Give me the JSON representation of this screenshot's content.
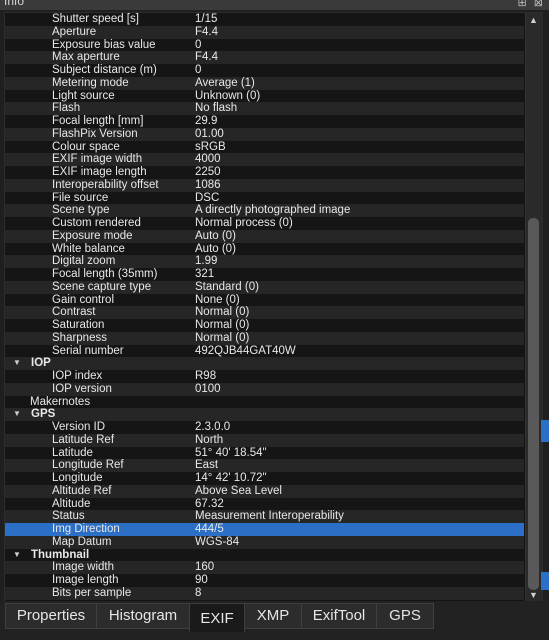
{
  "window": {
    "title": "Info",
    "controls": "⊞ ⊠"
  },
  "rows": [
    {
      "type": "field",
      "key": "Shutter speed [s]",
      "value": "1/15"
    },
    {
      "type": "field",
      "key": "Aperture",
      "value": "F4.4"
    },
    {
      "type": "field",
      "key": "Exposure bias value",
      "value": "0"
    },
    {
      "type": "field",
      "key": "Max aperture",
      "value": "F4.4"
    },
    {
      "type": "field",
      "key": "Subject distance (m)",
      "value": "0"
    },
    {
      "type": "field",
      "key": "Metering mode",
      "value": "Average (1)"
    },
    {
      "type": "field",
      "key": "Light source",
      "value": "Unknown (0)"
    },
    {
      "type": "field",
      "key": "Flash",
      "value": "No flash"
    },
    {
      "type": "field",
      "key": "Focal length [mm]",
      "value": "29.9"
    },
    {
      "type": "field",
      "key": "FlashPix Version",
      "value": "01.00"
    },
    {
      "type": "field",
      "key": "Colour space",
      "value": "sRGB"
    },
    {
      "type": "field",
      "key": "EXIF image width",
      "value": "4000"
    },
    {
      "type": "field",
      "key": "EXIF image length",
      "value": "2250"
    },
    {
      "type": "field",
      "key": "Interoperability offset",
      "value": "1086"
    },
    {
      "type": "field",
      "key": "File source",
      "value": "DSC"
    },
    {
      "type": "field",
      "key": "Scene type",
      "value": "A directly photographed image"
    },
    {
      "type": "field",
      "key": "Custom rendered",
      "value": "Normal process (0)"
    },
    {
      "type": "field",
      "key": "Exposure mode",
      "value": "Auto (0)"
    },
    {
      "type": "field",
      "key": "White balance",
      "value": "Auto (0)"
    },
    {
      "type": "field",
      "key": "Digital zoom",
      "value": "1.99"
    },
    {
      "type": "field",
      "key": "Focal length (35mm)",
      "value": "321"
    },
    {
      "type": "field",
      "key": "Scene capture type",
      "value": "Standard (0)"
    },
    {
      "type": "field",
      "key": "Gain control",
      "value": "None (0)"
    },
    {
      "type": "field",
      "key": "Contrast",
      "value": "Normal (0)"
    },
    {
      "type": "field",
      "key": "Saturation",
      "value": "Normal (0)"
    },
    {
      "type": "field",
      "key": "Sharpness",
      "value": "Normal (0)"
    },
    {
      "type": "field",
      "key": "Serial number",
      "value": "492QJB44GAT40W"
    },
    {
      "type": "group",
      "key": "IOP",
      "value": ""
    },
    {
      "type": "field",
      "key": "IOP index",
      "value": "R98"
    },
    {
      "type": "field",
      "key": "IOP version",
      "value": "0100"
    },
    {
      "type": "plain",
      "key": "Makernotes",
      "value": ""
    },
    {
      "type": "group",
      "key": "GPS",
      "value": ""
    },
    {
      "type": "field",
      "key": "Version ID",
      "value": "2.3.0.0"
    },
    {
      "type": "field",
      "key": "Latitude Ref",
      "value": "North"
    },
    {
      "type": "field",
      "key": "Latitude",
      "value": "51° 40' 18.54\""
    },
    {
      "type": "field",
      "key": "Longitude Ref",
      "value": "East"
    },
    {
      "type": "field",
      "key": "Longitude",
      "value": "14° 42' 10.72\""
    },
    {
      "type": "field",
      "key": "Altitude Ref",
      "value": "Above Sea Level"
    },
    {
      "type": "field",
      "key": "Altitude",
      "value": "67.32"
    },
    {
      "type": "field",
      "key": "Status",
      "value": "Measurement Interoperability"
    },
    {
      "type": "field",
      "key": "Img Direction",
      "value": "444/5",
      "selected": true
    },
    {
      "type": "field",
      "key": "Map Datum",
      "value": "WGS-84"
    },
    {
      "type": "group",
      "key": "Thumbnail",
      "value": ""
    },
    {
      "type": "field",
      "key": "Image width",
      "value": "160"
    },
    {
      "type": "field",
      "key": "Image length",
      "value": "90"
    },
    {
      "type": "field",
      "key": "Bits per sample",
      "value": "8"
    }
  ],
  "tabs": [
    {
      "label": "Properties",
      "active": false
    },
    {
      "label": "Histogram",
      "active": false
    },
    {
      "label": "EXIF",
      "active": true
    },
    {
      "label": "XMP",
      "active": false
    },
    {
      "label": "ExifTool",
      "active": false
    },
    {
      "label": "GPS",
      "active": false
    }
  ],
  "icons": {
    "expand": "triangle-down-icon",
    "scroll_up": "triangle-up-icon",
    "scroll_down": "triangle-down-icon"
  },
  "colors": {
    "selection": "#2b6fc7",
    "background": "#151515",
    "alt_row": "#262626"
  }
}
